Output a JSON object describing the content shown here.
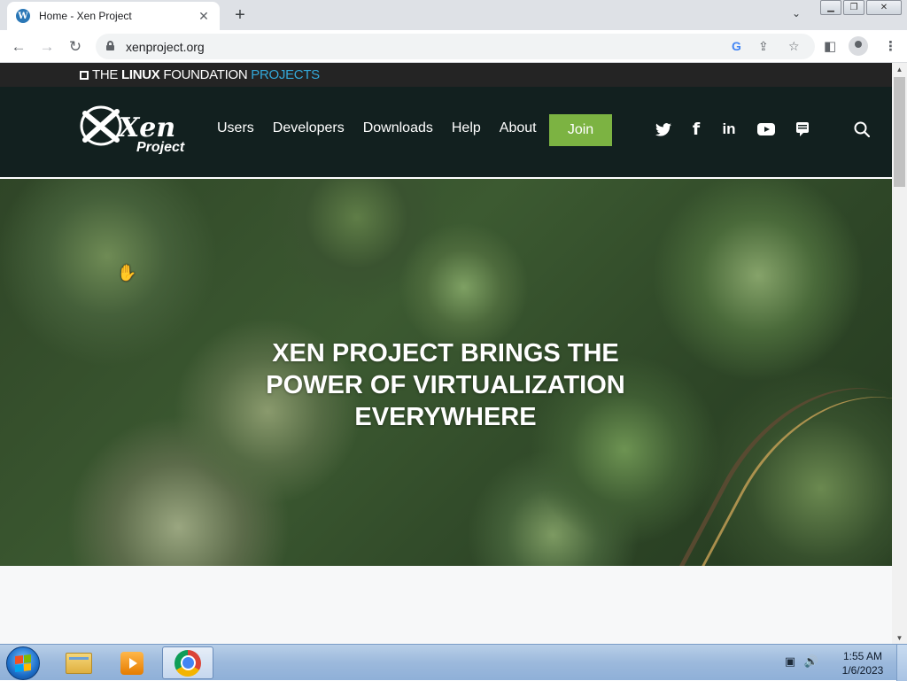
{
  "browser": {
    "tab": {
      "title": "Home - Xen Project",
      "favicon": "wordpress-icon"
    },
    "new_tab_label": "+",
    "address": {
      "url": "xenproject.org"
    },
    "window_controls": [
      "minimize",
      "restore",
      "close"
    ]
  },
  "site": {
    "lf_bar": {
      "prefix": "THE ",
      "bold": "LINUX",
      "middle": " FOUNDATION ",
      "accent": "PROJECTS"
    },
    "logo": {
      "word": "Xen",
      "sub": "Project"
    },
    "nav": [
      "Users",
      "Developers",
      "Downloads",
      "Help",
      "About"
    ],
    "join_label": "Join",
    "social_icons": [
      "twitter-icon",
      "facebook-icon",
      "linkedin-icon",
      "youtube-icon",
      "chat-icon"
    ],
    "social_labels": {
      "facebook": "f",
      "linkedin": "in"
    },
    "hero_title": "XEN PROJECT BRINGS THE POWER OF VIRTUALIZATION EVERYWHERE",
    "colors": {
      "header_bg": "#12201f",
      "join_bg": "#7cb342",
      "lf_accent": "#33a8d9"
    }
  },
  "taskbar": {
    "clock": {
      "time": "1:55 AM",
      "date": "1/6/2023"
    },
    "apps": [
      "windows-explorer-icon",
      "media-player-icon",
      "chrome-icon"
    ],
    "active_app": "chrome-icon"
  }
}
